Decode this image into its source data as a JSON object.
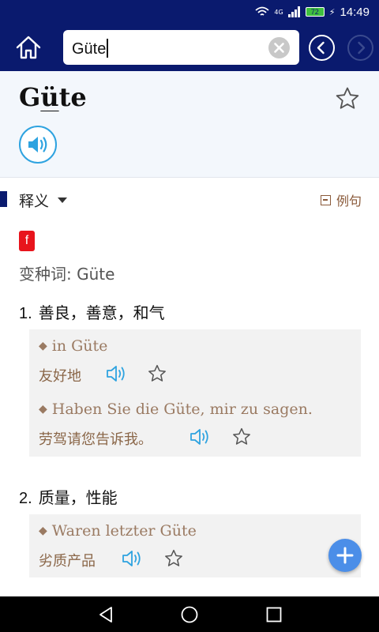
{
  "status_bar": {
    "signal_label": "4G",
    "battery": "72",
    "time": "14:49"
  },
  "header": {
    "search_value": "Güte"
  },
  "word": {
    "head_pre": "G",
    "head_stress": "ü",
    "head_post": "te"
  },
  "section": {
    "title": "释义",
    "example_toggle": "例句"
  },
  "entry": {
    "gender": "f",
    "variant": "变种词: Güte",
    "senses": [
      {
        "number": "1.",
        "meaning": "善良，善意，和气",
        "examples": [
          {
            "de": "in Güte",
            "zh": "友好地"
          },
          {
            "de": "Haben Sie die Güte, mir zu sagen.",
            "zh": "劳驾请您告诉我。"
          }
        ]
      },
      {
        "number": "2.",
        "meaning": "质量，性能",
        "examples": [
          {
            "de": "Waren letzter Güte",
            "zh": "劣质产品"
          }
        ]
      }
    ]
  },
  "colors": {
    "header_bg": "#0a1a6e",
    "accent_blue": "#2ea3e0",
    "example_text": "#9a7a62",
    "gender_badge": "#e8141c"
  },
  "icons": [
    "wifi-icon",
    "signal-icon",
    "battery-icon",
    "home-icon",
    "clear-icon",
    "back-arrow-icon",
    "forward-arrow-icon",
    "star-icon",
    "speaker-icon",
    "chevron-down-icon",
    "minus-box-icon",
    "plus-icon",
    "nav-back-icon",
    "nav-home-icon",
    "nav-recents-icon"
  ]
}
